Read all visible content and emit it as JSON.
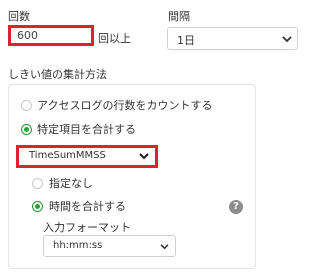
{
  "count": {
    "label": "回数",
    "value": "600",
    "suffix": "回以上"
  },
  "interval": {
    "label": "間隔",
    "selected": "1日"
  },
  "aggregation": {
    "title": "しきい値の集計方法",
    "options": [
      {
        "label": "アクセスログの行数をカウントする",
        "checked": false
      },
      {
        "label": "特定項目を合計する",
        "checked": true
      }
    ],
    "field_selected": "TimeSumMMSS",
    "sub_options": [
      {
        "label": "指定なし",
        "checked": false
      },
      {
        "label": "時間を合計する",
        "checked": true
      }
    ],
    "input_format_label": "入力フォーマット",
    "input_format_selected": "hh:mm:ss",
    "help_glyph": "?"
  },
  "colors": {
    "highlight_border": "#d9232e",
    "radio_checked": "#27a33a",
    "help_icon_bg": "#8c8c8c"
  },
  "icons": {
    "select_arrow": "chevron-down-icon",
    "help": "help-icon"
  }
}
